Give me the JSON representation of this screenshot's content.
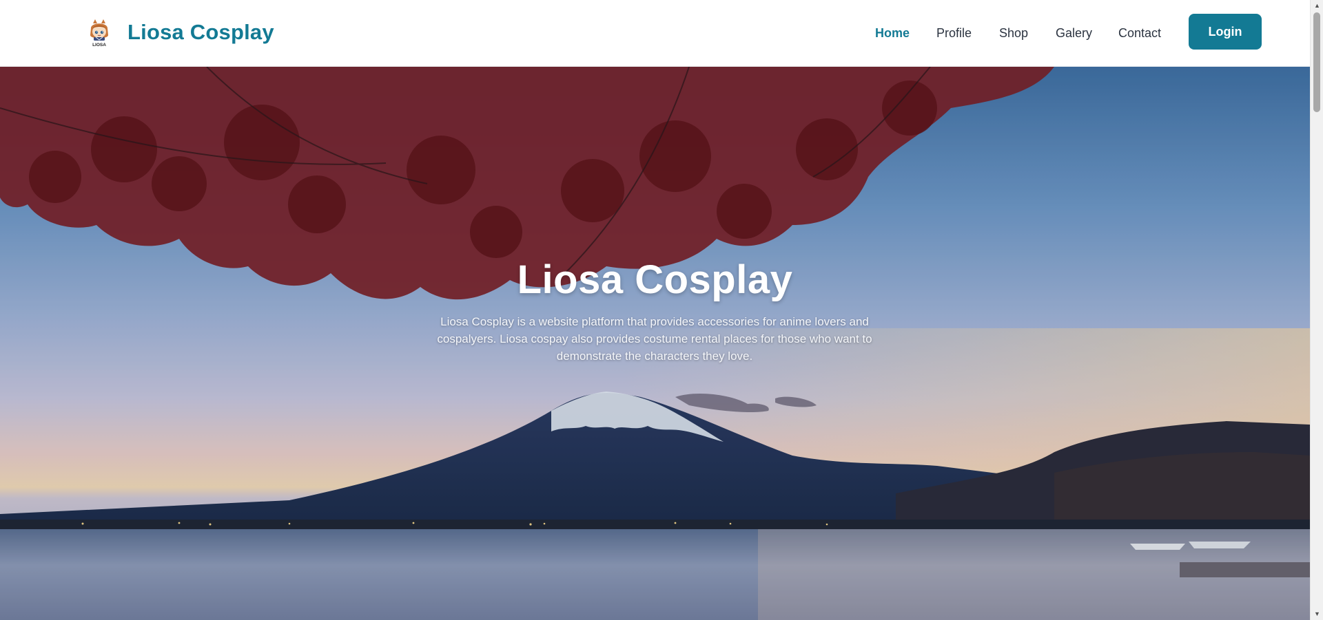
{
  "header": {
    "brand_name": "Liosa Cosplay",
    "logo_icon": "liosa-logo-icon",
    "nav": [
      {
        "label": "Home",
        "active": true
      },
      {
        "label": "Profile",
        "active": false
      },
      {
        "label": "Shop",
        "active": false
      },
      {
        "label": "Galery",
        "active": false
      },
      {
        "label": "Contact",
        "active": false
      }
    ],
    "login_label": "Login",
    "accent_color": "#137a94"
  },
  "hero": {
    "title": "Liosa Cosplay",
    "description": "Liosa Cosplay is a website platform that provides accessories for anime lovers and cospalyers. Liosa cospay also provides costume rental places for those who want to demonstrate the characters they love.",
    "background": "mount-fuji-lake-maple-photo"
  },
  "scrollbar": {
    "up_icon": "triangle-up-icon",
    "down_icon": "triangle-down-icon"
  }
}
